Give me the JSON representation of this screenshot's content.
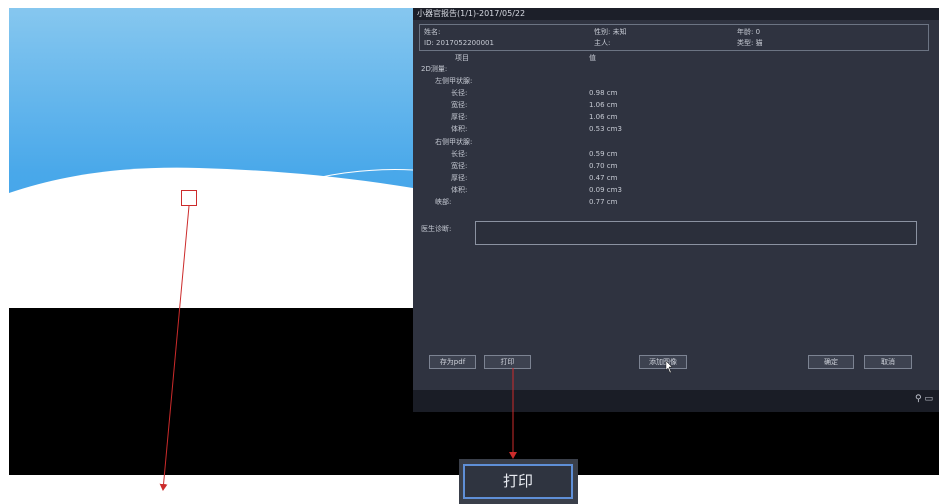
{
  "report": {
    "title": "小器官报告(1/1)-2017/05/22",
    "patient": {
      "name_label": "姓名:",
      "gender": "性别: 未知",
      "age": "年龄: 0",
      "id": "ID: 2017052200001",
      "owner": "主人:",
      "type": "类型: 猫"
    },
    "columns": {
      "item": "项目",
      "value": "值"
    },
    "section": "2D测量:",
    "left_thyroid": "左侧甲状腺:",
    "right_thyroid": "右侧甲状腺:",
    "measurements_left": [
      {
        "label": "长径:",
        "value": "0.98 cm"
      },
      {
        "label": "宽径:",
        "value": "1.06 cm"
      },
      {
        "label": "厚径:",
        "value": "1.06 cm"
      },
      {
        "label": "体积:",
        "value": "0.53 cm3"
      }
    ],
    "measurements_right": [
      {
        "label": "长径:",
        "value": "0.59 cm"
      },
      {
        "label": "宽径:",
        "value": "0.70 cm"
      },
      {
        "label": "厚径:",
        "value": "0.47 cm"
      },
      {
        "label": "体积:",
        "value": "0.09 cm3"
      }
    ],
    "isthmus": {
      "label": "峡部:",
      "value": "0.77 cm"
    },
    "diagnosis_label": "医生诊断:",
    "buttons": {
      "save_pdf": "存为pdf",
      "print": "打印",
      "add_image": "添加图像",
      "confirm": "确定",
      "cancel": "取消"
    }
  },
  "zoom_print_label": "打印",
  "colors": {
    "report_bg": "#2f3340",
    "arrow": "#cc2b2b",
    "highlight_border": "#5f8fd7"
  },
  "icons": [
    "usb-icon",
    "display-icon"
  ]
}
